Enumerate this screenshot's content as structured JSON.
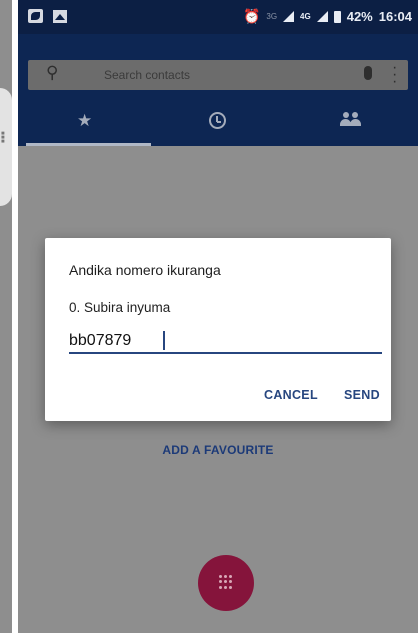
{
  "status_bar": {
    "alarm_icon": "alarm-icon",
    "net1": "3G",
    "net2": "4G",
    "battery": "42%",
    "time": "16:04"
  },
  "search": {
    "placeholder": "Search contacts"
  },
  "tabs": [
    {
      "icon": "star-icon",
      "active": true
    },
    {
      "icon": "clock-icon",
      "active": false
    },
    {
      "icon": "contacts-icon",
      "active": false
    }
  ],
  "favourites": {
    "add_label": "ADD A FAVOURITE"
  },
  "dialog": {
    "title": "Andika nomero ikuranga",
    "message": "0. Subira inyuma",
    "input_value": "bb07879",
    "cancel_label": "CANCEL",
    "send_label": "SEND"
  },
  "colors": {
    "status_bar": "#0c1f44",
    "app_bar": "#0d2653",
    "accent": "#27467f",
    "fab": "#85143b"
  }
}
